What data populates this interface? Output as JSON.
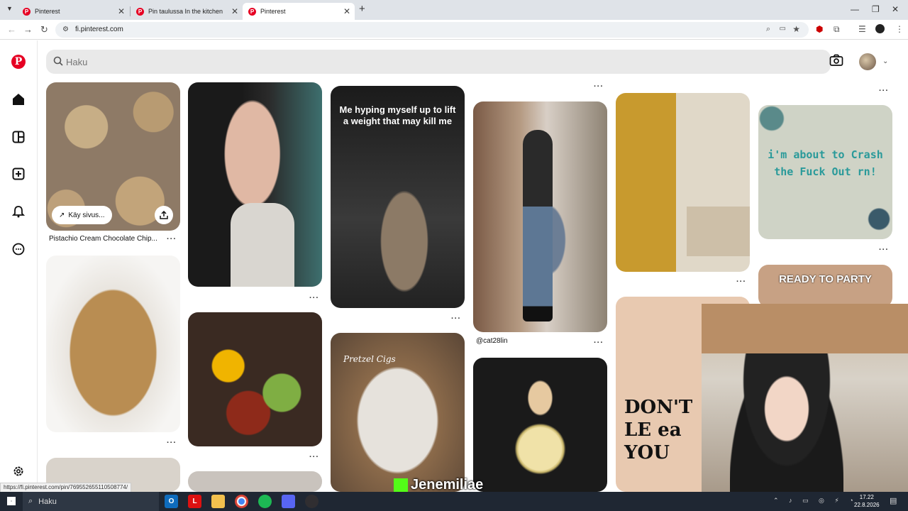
{
  "browser": {
    "tabs": [
      {
        "title": "Pinterest"
      },
      {
        "title": "Pin taulussa In the kitchen"
      },
      {
        "title": "Pinterest"
      }
    ],
    "url": "fi.pinterest.com",
    "status_url": "https://fi.pinterest.com/pin/769552655110508774/"
  },
  "search": {
    "placeholder": "Haku"
  },
  "pins": {
    "cookie_title": "Pistachio Cream Chocolate Chip...",
    "visit_label": "Käy sivus...",
    "meme_text": "Me hyping myself up to lift a weight that may kill me",
    "fashion_user": "@cat28lin",
    "crash_text": "i'm about to Crash the Fuck Out rn!",
    "party_text": "READY TO PARTY",
    "pretzel_text": "Pretzel Cigs",
    "dont_text": "DON'T LE ea YOU"
  },
  "overlay": {
    "streamer": "Jenemiliae"
  },
  "taskbar": {
    "search": "Haku",
    "time": "17.22",
    "date": "22.8.2026"
  }
}
